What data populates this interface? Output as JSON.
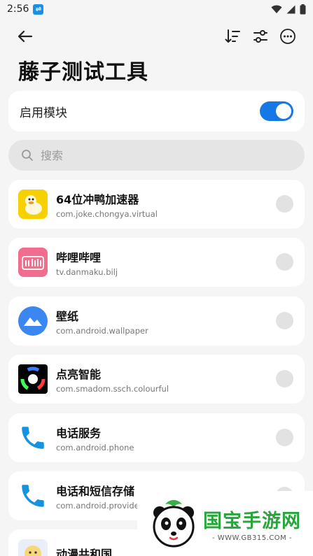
{
  "status_bar": {
    "time": "2:56",
    "notification_icon": "app-notification-icon",
    "icons": [
      "wifi-icon",
      "signal-icon",
      "battery-icon"
    ]
  },
  "toolbar": {
    "back_icon": "back-arrow-icon",
    "sort_icon": "sort-icon",
    "filter_icon": "filter-sliders-icon",
    "more_icon": "more-options-icon"
  },
  "page": {
    "title": "藤子测试工具"
  },
  "enable_module": {
    "label": "启用模块",
    "enabled": true,
    "accent_color": "#1677e6"
  },
  "search": {
    "placeholder": "搜索",
    "value": ""
  },
  "apps": [
    {
      "name": "64位冲鸭加速器",
      "package": "com.joke.chongya.virtual",
      "icon": "duck-icon",
      "checked": false
    },
    {
      "name": "哔哩哔哩",
      "package": "tv.danmaku.bilj",
      "icon": "bilibili-icon",
      "checked": false
    },
    {
      "name": "壁纸",
      "package": "com.android.wallpaper",
      "icon": "wallpaper-mountain-icon",
      "checked": false
    },
    {
      "name": "点亮智能",
      "package": "com.smadom.ssch.colourful",
      "icon": "color-wheel-icon",
      "checked": false
    },
    {
      "name": "电话服务",
      "package": "com.android.phone",
      "icon": "phone-icon",
      "checked": false
    },
    {
      "name": "电话和短信存储",
      "package": "com.android.providers.telephony",
      "icon": "phone-icon",
      "checked": false
    },
    {
      "name": "动漫共和国",
      "package": "",
      "icon": "anime-icon",
      "checked": false
    }
  ],
  "watermark": {
    "brand": "国宝手游网",
    "url": "- WWW.GB315.COM -",
    "logo": "panda-logo-icon"
  }
}
